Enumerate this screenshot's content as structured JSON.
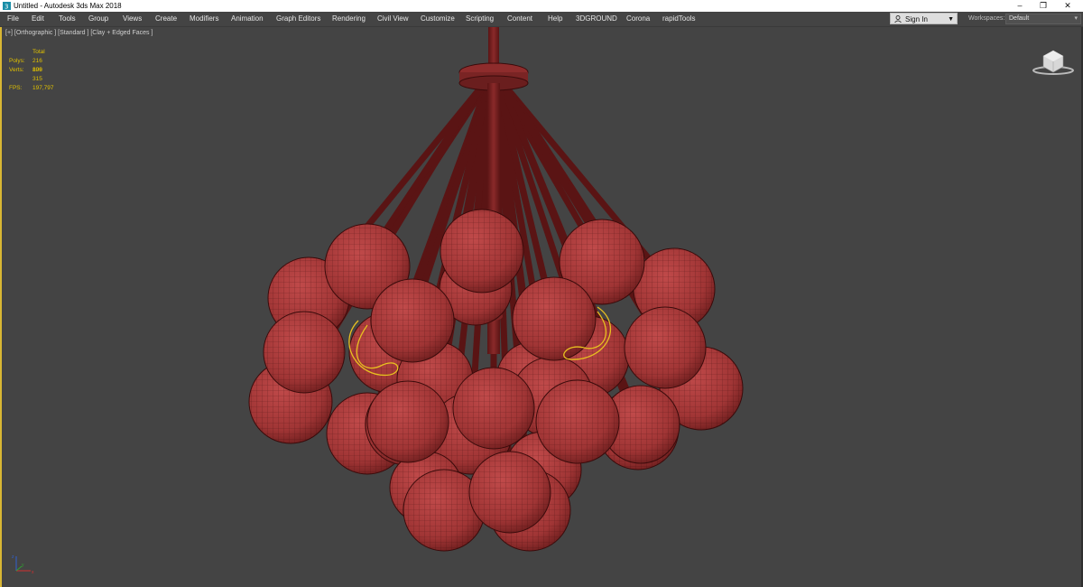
{
  "window": {
    "title": "Untitled - Autodesk 3ds Max 2018",
    "controls": {
      "minimize": "–",
      "maximize": "❐",
      "close": "✕"
    }
  },
  "menu": {
    "items": [
      "File",
      "Edit",
      "Tools",
      "Group",
      "Views",
      "Create",
      "Modifiers",
      "Animation",
      "Graph Editors",
      "Rendering",
      "Civil View",
      "Customize",
      "Scripting",
      "Content",
      "Help",
      "3DGROUND",
      "Corona",
      "rapidTools"
    ],
    "sign_in": "Sign In",
    "workspaces_label": "Workspaces:",
    "workspace_value": "Default"
  },
  "viewport": {
    "label": "[+] [Orthographic ] [Standard ] [Clay + Edged Faces ]",
    "stats": {
      "header": "Total",
      "polys_label": "Polys:",
      "polys_value": "216 896",
      "verts_label": "Verts:",
      "verts_value": "109 315",
      "fps_label": "FPS:",
      "fps_value": "197,797"
    },
    "axis": {
      "x": "x",
      "y": "y",
      "z": "z"
    }
  },
  "colors": {
    "viewport_bg": "#444444",
    "clay": "#a83838",
    "wire": "#3a0b0b",
    "stats_text": "#e0c000",
    "selection_curve": "#e8c020",
    "active_border": "#d9b733"
  }
}
